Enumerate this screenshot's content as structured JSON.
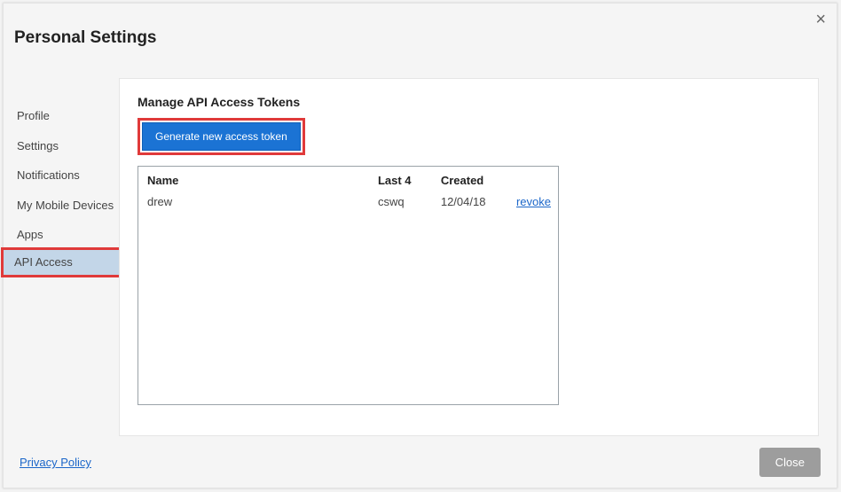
{
  "header": {
    "title": "Personal Settings",
    "close_glyph": "×"
  },
  "sidebar": {
    "items": [
      {
        "label": "Profile",
        "active": false
      },
      {
        "label": "Settings",
        "active": false
      },
      {
        "label": "Notifications",
        "active": false
      },
      {
        "label": "My Mobile Devices",
        "active": false
      },
      {
        "label": "Apps",
        "active": false
      },
      {
        "label": "API Access",
        "active": true
      }
    ]
  },
  "main": {
    "panel_title": "Manage API Access Tokens",
    "generate_button": "Generate new access token",
    "columns": {
      "name": "Name",
      "last4": "Last 4",
      "created": "Created"
    },
    "tokens": [
      {
        "name": "drew",
        "last4": "cswq",
        "created": "12/04/18",
        "action": "revoke"
      }
    ]
  },
  "footer": {
    "privacy": "Privacy Policy",
    "close": "Close"
  }
}
